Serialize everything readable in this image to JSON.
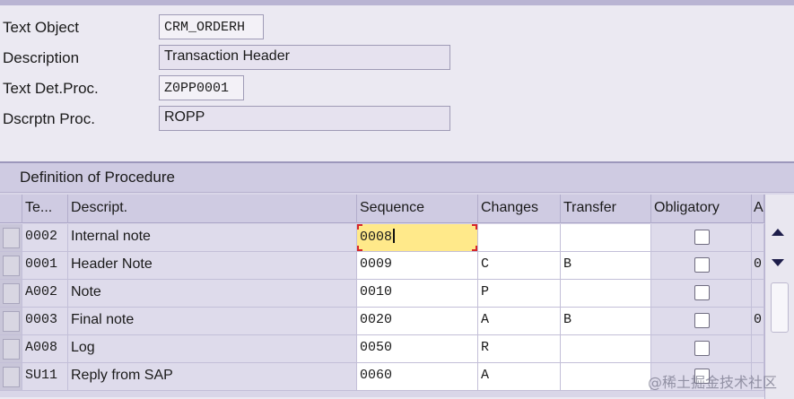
{
  "form": {
    "fields": [
      {
        "label": "Text Object",
        "value": "CRM_ORDERH"
      },
      {
        "label": "Description",
        "value": "Transaction Header"
      },
      {
        "label": "Text Det.Proc.",
        "value": "Z0PP0001"
      },
      {
        "label": "Dscrptn Proc.",
        "value": "ROPP"
      }
    ]
  },
  "procedure": {
    "title": "Definition of Procedure",
    "columns": [
      "Te...",
      "Descript.",
      "Sequence",
      "Changes",
      "Transfer",
      "Obligatory",
      "A"
    ],
    "rows": [
      {
        "te": "0002",
        "desc": "Internal note",
        "seq": "0008",
        "chg": "",
        "trf": "",
        "a": ""
      },
      {
        "te": "0001",
        "desc": "Header Note",
        "seq": "0009",
        "chg": "C",
        "trf": "B",
        "a": "0"
      },
      {
        "te": "A002",
        "desc": "Note",
        "seq": "0010",
        "chg": "P",
        "trf": "",
        "a": ""
      },
      {
        "te": "0003",
        "desc": "Final note",
        "seq": "0020",
        "chg": "A",
        "trf": "B",
        "a": "0"
      },
      {
        "te": "A008",
        "desc": "Log",
        "seq": "0050",
        "chg": "R",
        "trf": "",
        "a": ""
      },
      {
        "te": "SU11",
        "desc": "Reply from SAP",
        "seq": "0060",
        "chg": "A",
        "trf": "",
        "a": ""
      }
    ]
  },
  "watermark": "@稀土掘金技术社区",
  "colors": {
    "accent": "#d6262a",
    "active_cell": "#ffe98a",
    "header_bg": "#cfcbe2"
  }
}
